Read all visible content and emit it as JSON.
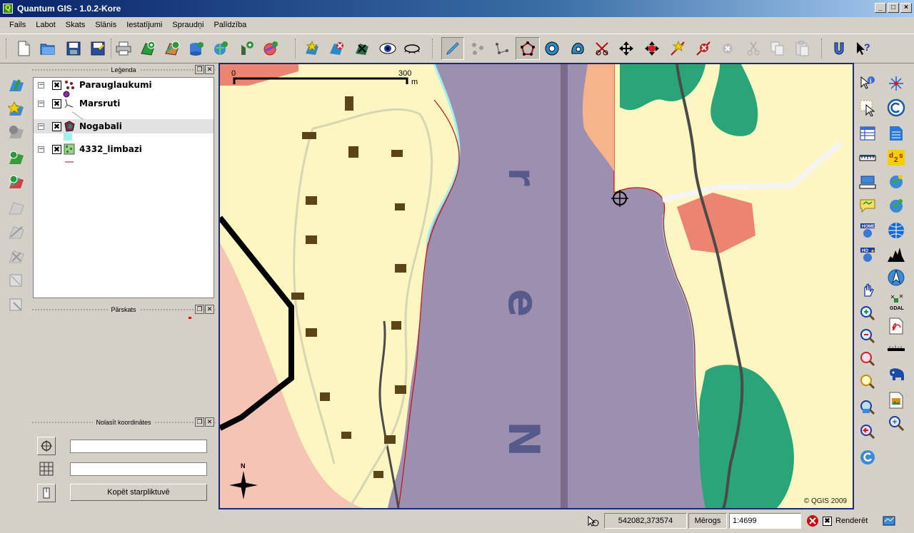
{
  "window": {
    "title": "Quantum GIS - 1.0.2-Kore",
    "controls": [
      "_",
      "□",
      "×"
    ]
  },
  "menu": [
    "Fails",
    "Labot",
    "Skats",
    "Slānis",
    "Iestatījumi",
    "Spraudņi",
    "Palīdzība"
  ],
  "legend_panel": {
    "title": "Leģenda",
    "layers": [
      {
        "name": "Parauglaukumi",
        "checked": "✖",
        "expander": "−"
      },
      {
        "name": "Marsruti",
        "checked": "✖",
        "expander": "−"
      },
      {
        "name": "Nogabali",
        "checked": "✖",
        "expander": "−"
      },
      {
        "name": "4332_limbazi",
        "checked": "✖",
        "expander": "−"
      }
    ]
  },
  "overview_panel": {
    "title": "Pārskats"
  },
  "coords_panel": {
    "title": "Nolasīt koordinātes",
    "field1": "",
    "field2": "",
    "copy_label": "Kopēt starpliktuvē"
  },
  "map": {
    "scalebar_start": "0",
    "scalebar_end": "300",
    "scalebar_unit": "m",
    "north_label": "N",
    "copyright": "© QGIS 2009",
    "letters": [
      "r",
      "e",
      "N"
    ]
  },
  "status": {
    "coordinates": "542082,373574",
    "scale_label": "Mērogs",
    "scale_value": "1:4699",
    "render_label": "Renderēt",
    "render_checked": "✖"
  },
  "colors": {
    "water": "#9d8fb0",
    "land": "#fdf6c0",
    "forest": "#2aa57a",
    "building": "#ec8470",
    "accent": "#0a246a"
  }
}
